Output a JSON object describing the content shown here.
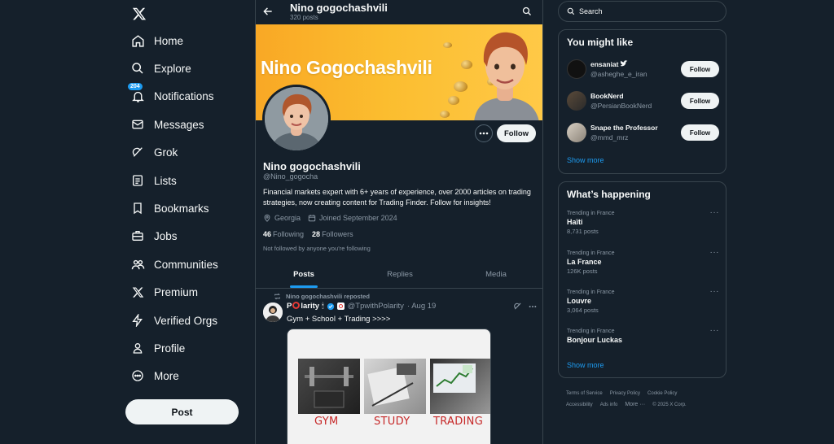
{
  "nav": {
    "items": [
      {
        "label": "Home",
        "icon": "home-icon"
      },
      {
        "label": "Explore",
        "icon": "search-icon"
      },
      {
        "label": "Notifications",
        "icon": "bell-icon",
        "badge": "204"
      },
      {
        "label": "Messages",
        "icon": "mail-icon"
      },
      {
        "label": "Grok",
        "icon": "grok-icon"
      },
      {
        "label": "Lists",
        "icon": "list-icon"
      },
      {
        "label": "Bookmarks",
        "icon": "bookmark-icon"
      },
      {
        "label": "Jobs",
        "icon": "briefcase-icon"
      },
      {
        "label": "Communities",
        "icon": "people-icon"
      },
      {
        "label": "Premium",
        "icon": "x-logo-icon"
      },
      {
        "label": "Verified Orgs",
        "icon": "lightning-icon"
      },
      {
        "label": "Profile",
        "icon": "person-icon"
      },
      {
        "label": "More",
        "icon": "more-circle-icon"
      }
    ],
    "post_label": "Post"
  },
  "header": {
    "name": "Nino gogochashvili",
    "post_count": "320 posts"
  },
  "banner": {
    "title": "Nino Gogochashvili",
    "colors": {
      "start": "#f9a825",
      "end": "#ffc947"
    }
  },
  "profile": {
    "follow_label": "Follow",
    "name": "Nino gogochashvili",
    "handle": "@Nino_gogocha",
    "bio": "Financial markets expert with 6+ years of experience, over 2000 articles on trading strategies, now creating content for Trading Finder. Follow for insights!",
    "location": "Georgia",
    "joined": "Joined September 2024",
    "following_count": "46",
    "following_label": "Following",
    "followers_count": "28",
    "followers_label": "Followers",
    "not_followed": "Not followed by anyone you’re following"
  },
  "tabs": [
    {
      "label": "Posts",
      "active": true
    },
    {
      "label": "Replies",
      "active": false
    },
    {
      "label": "Media",
      "active": false
    }
  ],
  "tweet": {
    "repost_text": "Nino gogochashvili reposted",
    "author_p": "P",
    "author_rest": "larity",
    "author_extra": "🕯",
    "handle": "@TpwithPolarity",
    "date": "· Aug 19",
    "text": "Gym + School + Trading >>>>",
    "media_labels": [
      "GYM",
      "STUDY",
      "TRADING"
    ]
  },
  "search": {
    "placeholder": "Search"
  },
  "who_to_follow": {
    "title": "You might like",
    "users": [
      {
        "name": "ensaniat",
        "handle": "@asheghe_e_iran",
        "follow": "Follow"
      },
      {
        "name": "BookNerd",
        "handle": "@PersianBookNerd",
        "follow": "Follow"
      },
      {
        "name": "Snape the Professor",
        "handle": "@mmd_mrz",
        "follow": "Follow"
      }
    ],
    "show_more": "Show more"
  },
  "happening": {
    "title": "What’s happening",
    "trends": [
      {
        "context": "Trending in France",
        "topic": "Haïti",
        "posts": "8,731 posts"
      },
      {
        "context": "Trending in France",
        "topic": "La France",
        "posts": "126K posts"
      },
      {
        "context": "Trending in France",
        "topic": "Louvre",
        "posts": "3,064 posts"
      },
      {
        "context": "Trending in France",
        "topic": "Bonjour Luckas",
        "posts": ""
      }
    ],
    "show_more": "Show more"
  },
  "footer": {
    "links": [
      "Terms of Service",
      "Privacy Policy",
      "Cookie Policy",
      "Accessibility",
      "Ads info",
      "More ···"
    ],
    "copyright": "© 2025 X Corp."
  },
  "colors": {
    "background": "#15202b",
    "border": "#38444d",
    "accent": "#1d9bf0",
    "muted": "#8b98a5"
  }
}
